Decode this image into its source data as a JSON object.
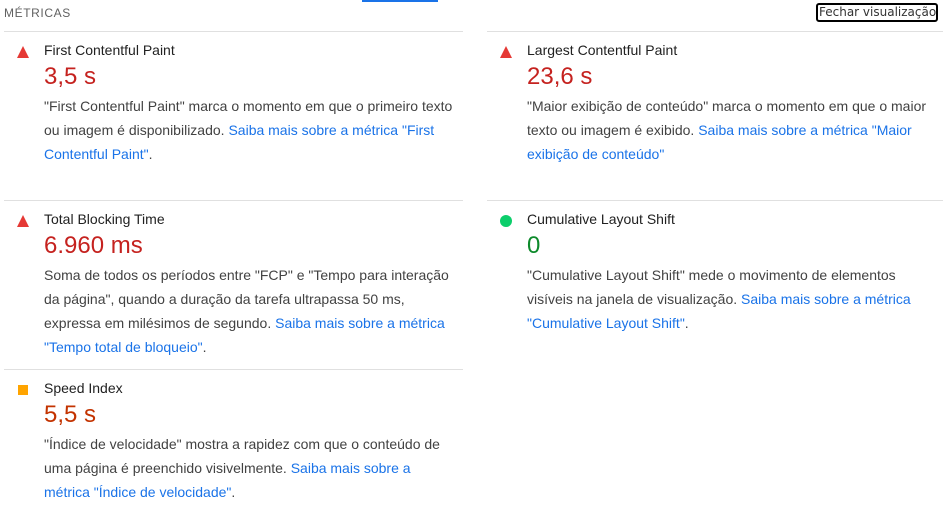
{
  "header": {
    "title": "MÉTRICAS",
    "close_button": "Fechar visualização"
  },
  "colors": {
    "fail": "#e53935",
    "average": "#ffa400",
    "pass": "#0cce6b",
    "link": "#1a73e8"
  },
  "metrics": [
    {
      "name": "First Contentful Paint",
      "value": "3,5 s",
      "status": "fail",
      "icon": "red-triangle-icon",
      "description": "\"First Contentful Paint\" marca o momento em que o primeiro texto ou imagem é disponibilizado. ",
      "link": "Saiba mais sobre a métrica \"First Contentful Paint\"",
      "after": "."
    },
    {
      "name": "Largest Contentful Paint",
      "value": "23,6 s",
      "status": "fail",
      "icon": "red-triangle-icon",
      "description": "\"Maior exibição de conteúdo\" marca o momento em que o maior texto ou imagem é exibido. ",
      "link": "Saiba mais sobre a métrica \"Maior exibição de conteúdo\"",
      "after": ""
    },
    {
      "name": "Total Blocking Time",
      "value": "6.960 ms",
      "status": "fail",
      "icon": "red-triangle-icon",
      "description": "Soma de todos os períodos entre \"FCP\" e \"Tempo para interação da página\", quando a duração da tarefa ultrapassa 50 ms, expressa em milésimos de segundo. ",
      "link": "Saiba mais sobre a métrica \"Tempo total de bloqueio\"",
      "after": "."
    },
    {
      "name": "Cumulative Layout Shift",
      "value": "0",
      "status": "pass",
      "icon": "green-circle-icon",
      "description": "\"Cumulative Layout Shift\" mede o movimento de elementos visíveis na janela de visualização. ",
      "link": "Saiba mais sobre a métrica \"Cumulative Layout Shift\"",
      "after": "."
    },
    {
      "name": "Speed Index",
      "value": "5,5 s",
      "status": "average",
      "icon": "orange-square-icon",
      "description": "\"Índice de velocidade\" mostra a rapidez com que o conteúdo de uma página é preenchido visivelmente. ",
      "link": "Saiba mais sobre a métrica \"Índice de velocidade\"",
      "after": "."
    }
  ]
}
